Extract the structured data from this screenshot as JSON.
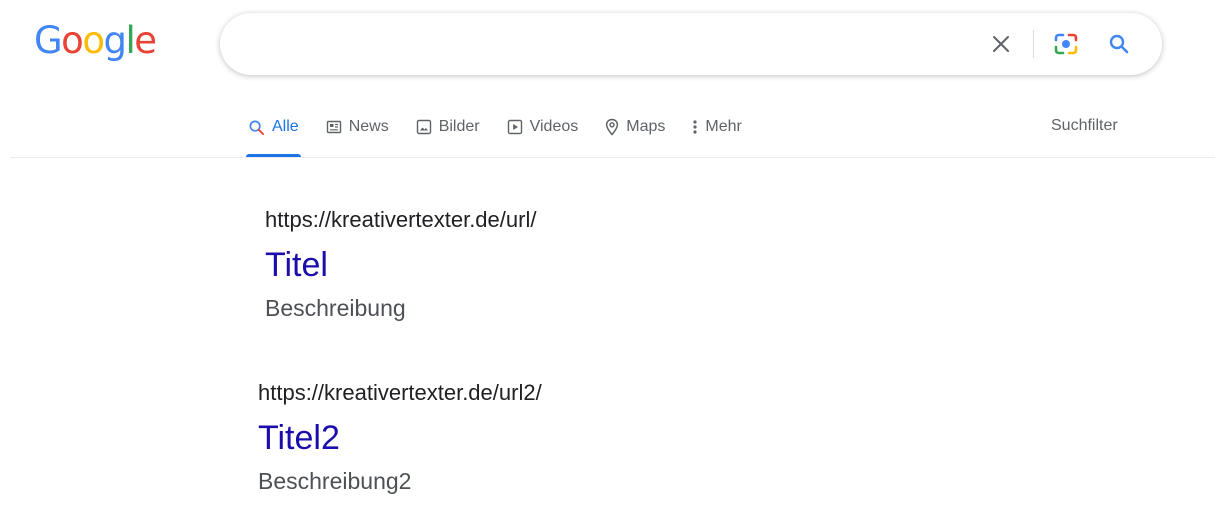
{
  "logo": {
    "letters": [
      "G",
      "o",
      "o",
      "g",
      "l",
      "e"
    ],
    "colors": [
      "#4285F4",
      "#EA4335",
      "#FBBC05",
      "#4285F4",
      "#34A853",
      "#EA4335"
    ]
  },
  "search": {
    "value": "",
    "placeholder": "",
    "icons": [
      "close-icon",
      "camera-lens-icon",
      "search-icon"
    ]
  },
  "tabs": [
    {
      "label": "Alle",
      "icon": "search-icon",
      "active": true
    },
    {
      "label": "News",
      "icon": "news-icon",
      "active": false
    },
    {
      "label": "Bilder",
      "icon": "image-icon",
      "active": false
    },
    {
      "label": "Videos",
      "icon": "video-icon",
      "active": false
    },
    {
      "label": "Maps",
      "icon": "map-pin-icon",
      "active": false
    },
    {
      "label": "Mehr",
      "icon": "more-vert-icon",
      "active": false
    }
  ],
  "filter_label": "Suchfilter",
  "results": [
    {
      "url": "https://kreativertexter.de/url/",
      "title": "Titel",
      "description": "Beschreibung"
    },
    {
      "url": "https://kreativertexter.de/url2/",
      "title": "Titel2",
      "description": "Beschreibung2"
    }
  ],
  "colors": {
    "accent": "#1a73e8",
    "link": "#1a0dab",
    "muted": "#5f6368"
  }
}
